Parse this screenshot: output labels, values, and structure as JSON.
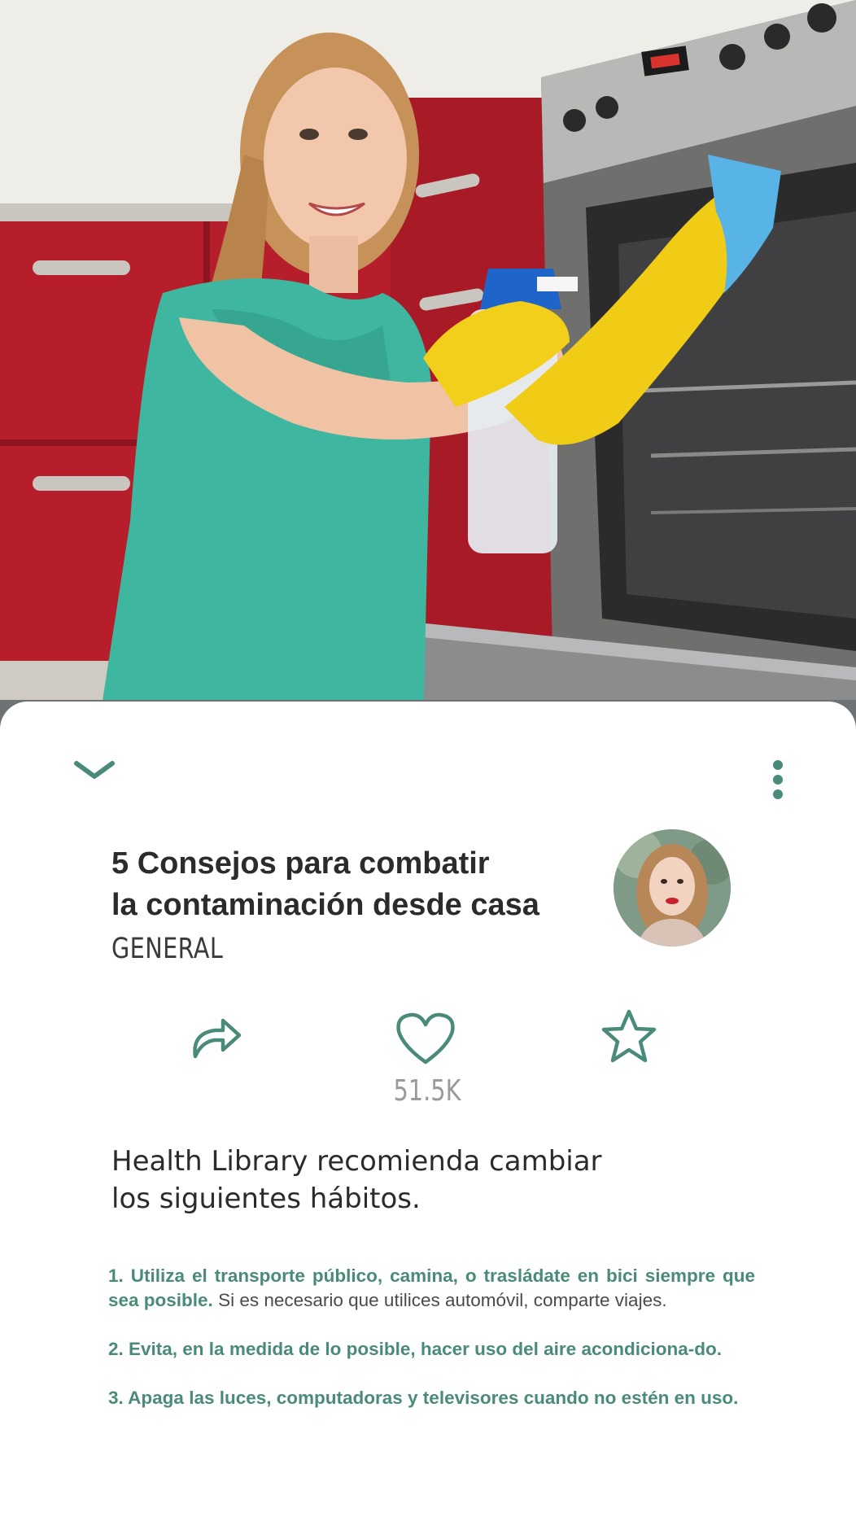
{
  "colors": {
    "accent": "#4a8a7b",
    "title": "#2b2b2b",
    "muted": "#9a9a9a"
  },
  "hero": {
    "image_description_icon": "woman-cleaning-oven-photo"
  },
  "header": {
    "collapse_icon": "chevron-down-icon",
    "menu_icon": "more-vertical-icon"
  },
  "article": {
    "title": "5 Consejos para combatir\nla contaminación desde casa",
    "category": "GENERAL",
    "author_avatar_icon": "author-avatar"
  },
  "actions": {
    "share_icon": "share-icon",
    "like_icon": "heart-icon",
    "like_count": "51.5K",
    "favorite_icon": "star-icon"
  },
  "intro": "Health Library recomienda cambiar\nlos siguientes hábitos.",
  "tips": [
    {
      "highlight": "1. Utiliza el transporte público, camina, o trasládate en bici siempre que sea posible.",
      "text": " Si es necesario que utilices automóvil, comparte viajes."
    },
    {
      "highlight": "2. Evita, en la medida de lo posible, hacer uso del aire acondiciona-do.",
      "text": ""
    },
    {
      "highlight": "3. Apaga las luces, computadoras y televisores cuando no estén en uso.",
      "text": ""
    }
  ]
}
